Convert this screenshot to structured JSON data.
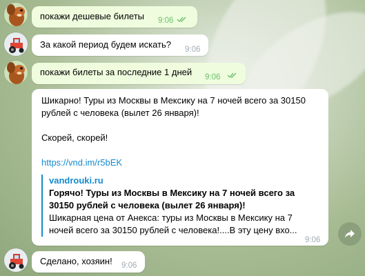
{
  "messages": [
    {
      "id": "m1",
      "direction": "out",
      "text": "покажи дешевые билеты",
      "time": "9:06",
      "read": true
    },
    {
      "id": "m2",
      "direction": "in",
      "text": "За какой период будем искать?",
      "time": "9:06"
    },
    {
      "id": "m3",
      "direction": "out",
      "text": "покажи билеты за последние 1 дней",
      "time": "9:06",
      "read": true
    },
    {
      "id": "m4",
      "direction": "in",
      "text_line1": "Шикарно! Туры из Москвы в Мексику на 7 ночей всего за 30150",
      "text_line2": "рублей с человека (вылет 26 января)!",
      "text_line3": "Скорей, скорей!",
      "link": "https://vnd.im/r5bEK",
      "preview": {
        "site": "vandrouki.ru",
        "title_line1": "Горячо! Туры из Москвы в Мексику на 7 ночей всего за",
        "title_line2": "30150 рублей с человека (вылет 26 января)!",
        "desc_line1": "Шикарная цена от Анекса: туры из Москвы в Мексику на 7",
        "desc_line2": "ночей всего за 30150 рублей с человека!....В эту цену вхо..."
      },
      "time": "9:06"
    },
    {
      "id": "m5",
      "direction": "in",
      "text": "Сделано, хозяин!",
      "time": "9:06"
    }
  ],
  "icons": {
    "user_avatar": "squirrel-avatar-icon",
    "bot_avatar": "tractor-avatar-icon",
    "read_ticks": "double-check-icon",
    "forward": "share-arrow-icon"
  },
  "colors": {
    "outgoing_bubble": "#effdde",
    "incoming_bubble": "#ffffff",
    "link": "#168acd",
    "time_out": "#6cbf6f",
    "time_in": "#a0acb6"
  }
}
